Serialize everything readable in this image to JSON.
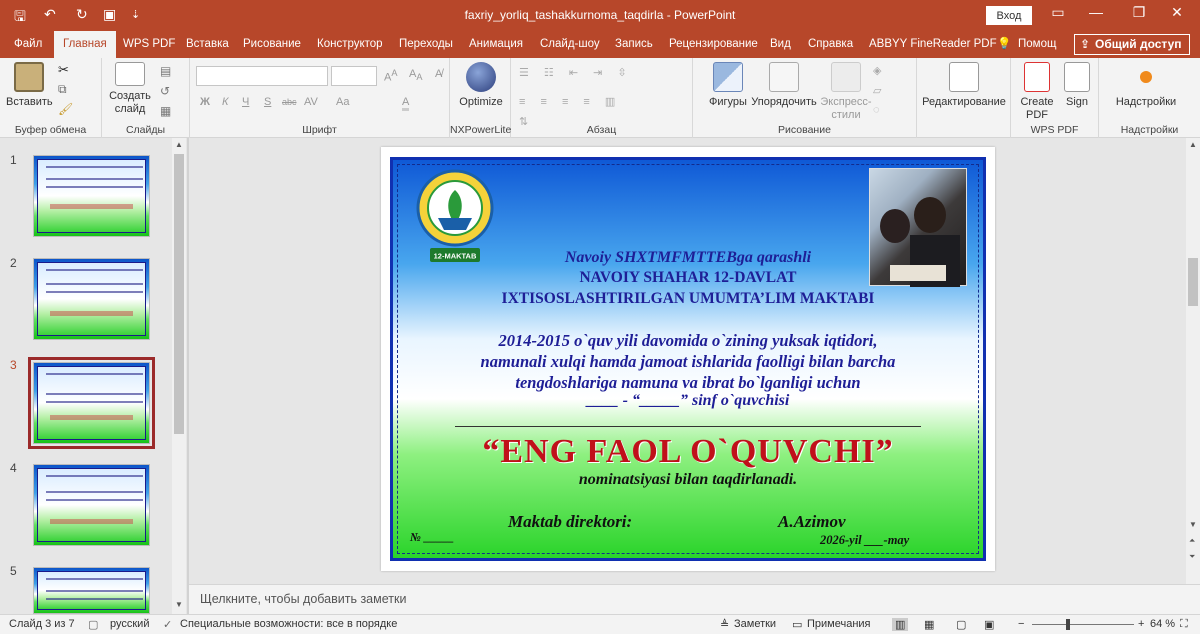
{
  "window": {
    "title": "faxriy_yorliq_tashakkurnoma_taqdirla  -  PowerPoint",
    "login_label": "Вход",
    "qat": [
      "save-icon",
      "undo-icon",
      "redo-icon",
      "start-slideshow-icon",
      "customize-icon"
    ]
  },
  "menu": {
    "tabs": [
      "Файл",
      "Главная",
      "WPS PDF",
      "Вставка",
      "Рисование",
      "Конструктор",
      "Переходы",
      "Анимация",
      "Слайд-шоу",
      "Запись",
      "Рецензирование",
      "Вид",
      "Справка",
      "ABBYY FineReader PDF",
      "Помощ"
    ],
    "share_label": "Общий доступ"
  },
  "ribbon": {
    "paste": "Вставить",
    "new_slide_1": "Создать",
    "new_slide_2": "слайд",
    "optimize": "Optimize",
    "shapes": "Фигуры",
    "arrange": "Упорядочить",
    "quick_styles_1": "Экспресс-",
    "quick_styles_2": "стили",
    "editing": "Редактирование",
    "create_pdf_1": "Create",
    "create_pdf_2": "PDF",
    "sign": "Sign",
    "addins": "Надстройки",
    "groups": [
      "Буфер обмена",
      "Слайды",
      "Шрифт",
      "NXPowerLite",
      "Абзац",
      "Рисование",
      "WPS PDF",
      "Надстройки"
    ],
    "font_buttons": [
      "Ж",
      "К",
      "Ч",
      "S",
      "abc",
      "AV",
      "Aa",
      "A"
    ]
  },
  "thumbnails": {
    "numbers": [
      "1",
      "2",
      "3",
      "4",
      "5"
    ],
    "selected": 3
  },
  "slide": {
    "line1": "Navoiy SHXTMFMTTEBga qarashli",
    "line2": "NAVOIY SHAHAR 12-DAVLAT",
    "line3": "IXTISOSLASHTIRILGAN  UMUMTA’LIM MAKTABI",
    "body1": "2014-2015 o`quv yili davomida o`zining yuksak iqtidori,",
    "body2": "namunali xulqi hamda jamoat ishlarida faolligi bilan barcha",
    "body3": "tengdoshlariga namuna va ibrat bo`lganligi uchun",
    "body4": "____ - “_____”  sinf o`quvchisi",
    "award": "“ENG FAOL O`QUVCHI”",
    "nomination": "nominatsiyasi bilan taqdirlanadi.",
    "director_label": "Maktab direktori:",
    "director_name": "A.Azimov",
    "number_label": "№ _____",
    "date": "2026-yil ___-may",
    "logo_text": "12-MAKTAB"
  },
  "notes_placeholder": "Щелкните, чтобы добавить заметки",
  "status": {
    "slide_of": "Слайд 3 из 7",
    "language": "русский",
    "accessibility": "Специальные возможности: все в порядке",
    "notes": "Заметки",
    "comments": "Примечания",
    "zoom": "64 %"
  },
  "colors": {
    "accent": "#b7472a",
    "award_red": "#c0101a",
    "cert_text_blue": "#1e1e96"
  }
}
